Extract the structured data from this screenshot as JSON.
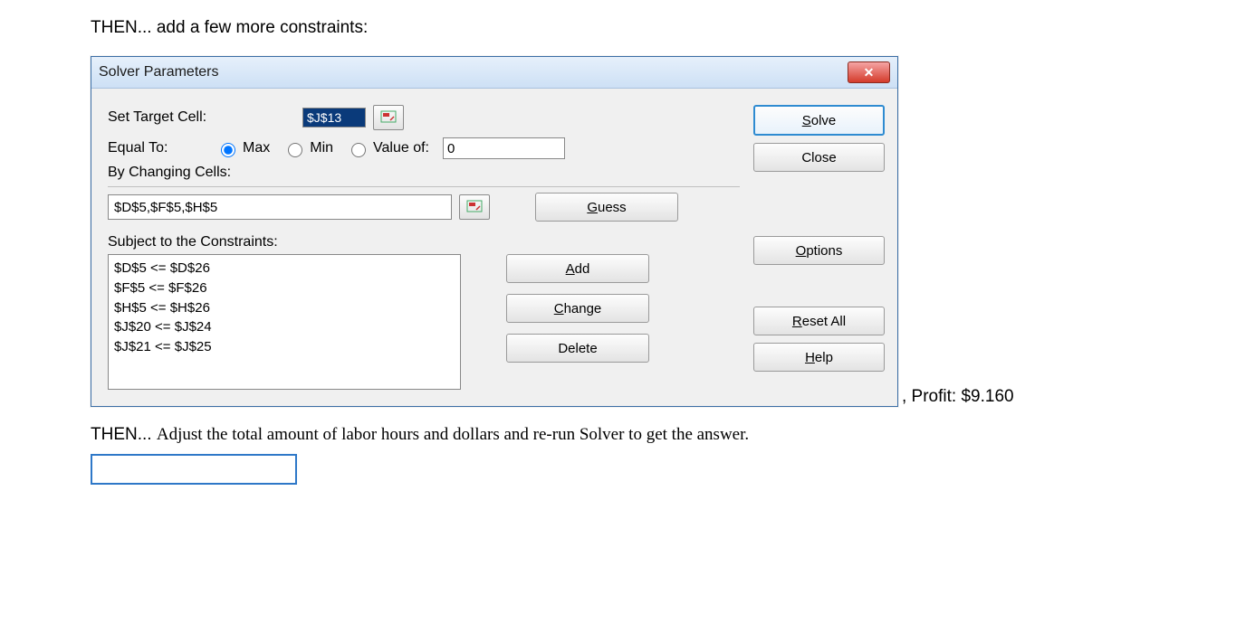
{
  "intro": "THEN... add a few more constraints:",
  "dialog": {
    "title": "Solver Parameters",
    "target_label": "Set Target Cell:",
    "target_value": "$J$13",
    "equal_to_label": "Equal To:",
    "radio_max": "Max",
    "radio_min": "Min",
    "radio_valueof": "Value of:",
    "valueof_input": "0",
    "by_changing_label": "By Changing Cells:",
    "changing_value": "$D$5,$F$5,$H$5",
    "guess_label": "Guess",
    "constraints_label": "Subject to the Constraints:",
    "constraints": [
      "$D$5 <= $D$26",
      "$F$5 <= $F$26",
      "$H$5 <= $H$26",
      "$J$20 <= $J$24",
      "$J$21 <= $J$25"
    ],
    "add_label": "Add",
    "change_label": "Change",
    "delete_label": "Delete",
    "solve_label": "Solve",
    "close_label": "Close",
    "options_label": "Options",
    "reset_label": "Reset All",
    "help_label": "Help"
  },
  "profit_note": ", Profit: $9.160",
  "outro_then": "THEN... ",
  "outro_rest": "Adjust the total amount of labor hours and dollars and re-run Solver to get the answer."
}
